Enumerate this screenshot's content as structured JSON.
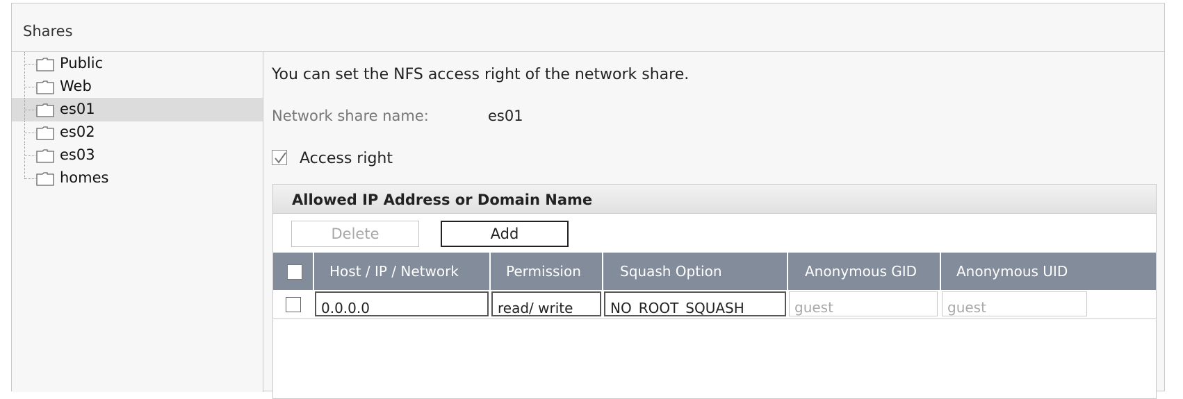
{
  "panel": {
    "title": "Shares"
  },
  "tree": {
    "items": [
      {
        "label": "Public",
        "selected": false
      },
      {
        "label": "Web",
        "selected": false
      },
      {
        "label": "es01",
        "selected": true
      },
      {
        "label": "es02",
        "selected": false
      },
      {
        "label": "es03",
        "selected": false
      },
      {
        "label": "homes",
        "selected": false
      }
    ],
    "icon": "folder-icon"
  },
  "content": {
    "description": "You can set the NFS access right of the network share.",
    "share_name_label": "Network share name:",
    "share_name_value": "es01",
    "access_right_label": "Access right",
    "access_right_checked": true
  },
  "section": {
    "title": "Allowed IP Address or Domain Name",
    "delete_label": "Delete",
    "add_label": "Add",
    "columns": [
      "Host / IP / Network",
      "Permission",
      "Squash Option",
      "Anonymous GID",
      "Anonymous UID"
    ],
    "rows": [
      {
        "host": "0.0.0.0",
        "permission": "read/ write",
        "squash": "NO_ROOT_SQUASH",
        "gid_placeholder": "guest",
        "uid_placeholder": "guest"
      }
    ]
  },
  "colors": {
    "grid_header_bg": "#838c9b",
    "selected_row_bg": "#dcdcdc",
    "panel_bg": "#f7f7f7"
  }
}
